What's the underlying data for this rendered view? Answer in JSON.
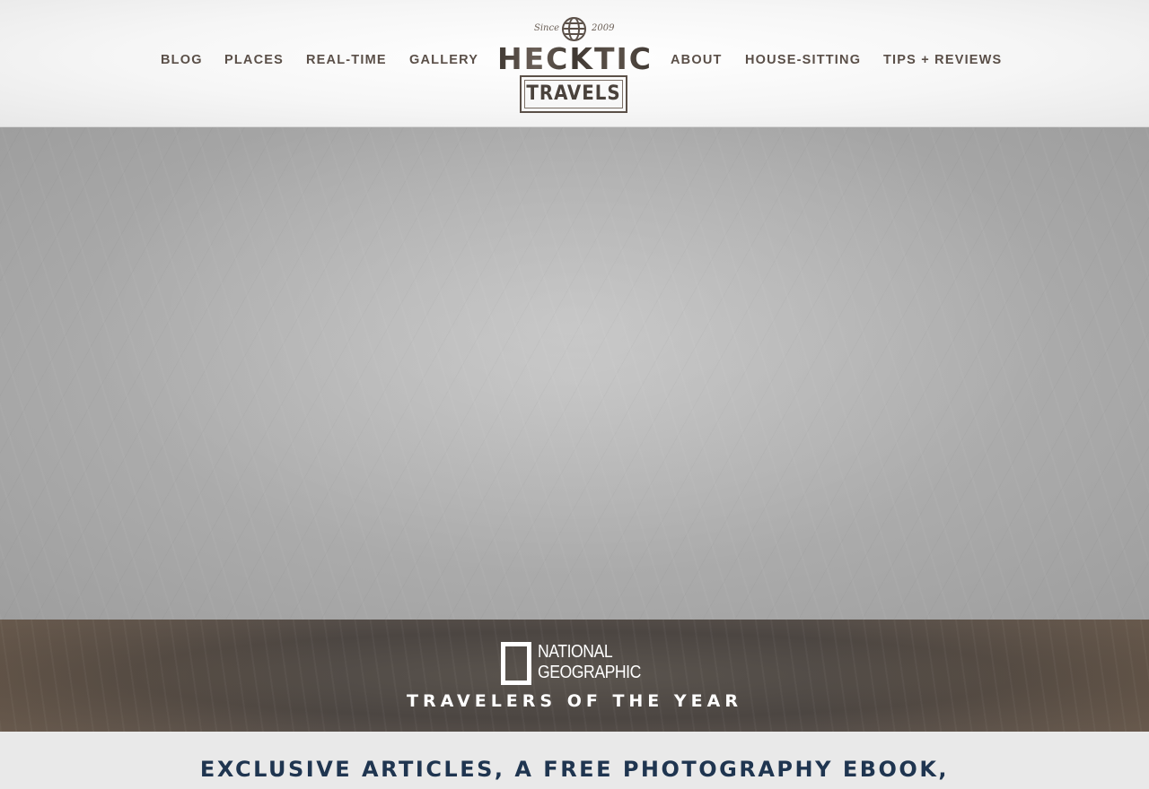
{
  "nav": {
    "left": [
      "BLOG",
      "PLACES",
      "REAL-TIME",
      "GALLERY"
    ],
    "right": [
      "ABOUT",
      "HOUSE-SITTING",
      "TIPS + REVIEWS"
    ]
  },
  "logo": {
    "since_left": "Since",
    "since_right": "2009",
    "name": "HECKTIC",
    "sub": "TRAVELS",
    "globe_icon": "globe-icon"
  },
  "natgeo": {
    "line1": "NATIONAL",
    "line2": "GEOGRAPHIC",
    "title": "TRAVELERS OF THE YEAR"
  },
  "subscribe": {
    "heading": "EXCLUSIVE ARTICLES, A FREE PHOTOGRAPHY EBOOK,"
  },
  "colors": {
    "nav_text": "#5a4f48",
    "heading": "#1f3550"
  }
}
